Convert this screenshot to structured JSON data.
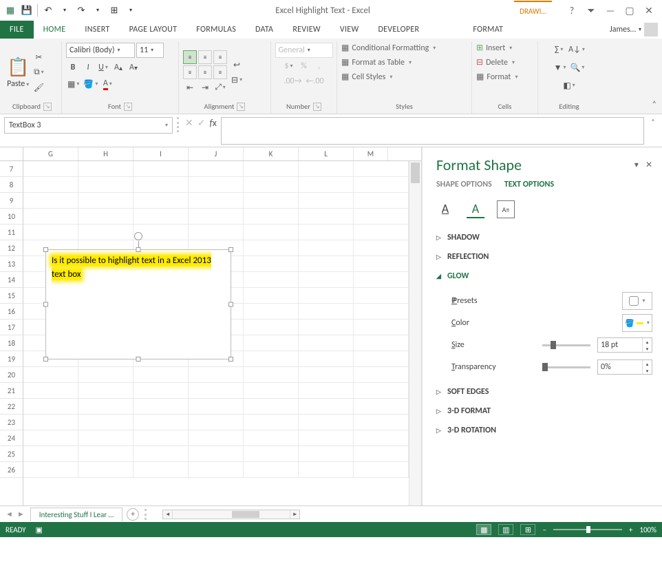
{
  "title": "Excel Highlight Text - Excel",
  "drawing_tools_label": "DRAWI…",
  "username": "James…",
  "tabs": {
    "file": "FILE",
    "home": "HOME",
    "insert": "INSERT",
    "pagelayout": "PAGE LAYOUT",
    "formulas": "FORMULAS",
    "data": "DATA",
    "review": "REVIEW",
    "view": "VIEW",
    "developer": "DEVELOPER",
    "format": "FORMAT"
  },
  "ribbon": {
    "paste": "Paste",
    "font_name": "Calibri (Body)",
    "font_size": "11",
    "number_format": "General",
    "cond_format": "Conditional Formatting",
    "format_table": "Format as Table",
    "cell_styles": "Cell Styles",
    "insert": "Insert",
    "delete": "Delete",
    "format": "Format",
    "clipboard": "Clipboard",
    "font": "Font",
    "alignment": "Alignment",
    "number": "Number",
    "styles": "Styles",
    "cells": "Cells",
    "editing": "Editing"
  },
  "namebox": "TextBox 3",
  "columns": [
    "G",
    "H",
    "I",
    "J",
    "K",
    "L",
    "M"
  ],
  "rows": [
    "7",
    "8",
    "9",
    "10",
    "11",
    "12",
    "13",
    "14",
    "15",
    "16",
    "17",
    "18",
    "19",
    "20",
    "21",
    "22",
    "23",
    "24",
    "25",
    "26"
  ],
  "textbox_text": "Is it possible to highlight text in a Excel 2013 text box",
  "pane": {
    "title": "Format Shape",
    "tabs": {
      "shape": "SHAPE OPTIONS",
      "text": "TEXT OPTIONS"
    },
    "sections": {
      "shadow": "SHADOW",
      "reflection": "REFLECTION",
      "glow": "GLOW",
      "softedges": "SOFT EDGES",
      "fmt3d": "3-D FORMAT",
      "rot3d": "3-D ROTATION"
    },
    "glow": {
      "presets": "Presets",
      "color": "Color",
      "size_label": "Size",
      "size_val": "18 pt",
      "trans_label": "Transparency",
      "trans_val": "0%"
    }
  },
  "sheet_tab": "Interesting Stuff I Lear …",
  "status": {
    "ready": "READY",
    "zoom": "100%",
    "plus": "+",
    "minus": "–"
  }
}
